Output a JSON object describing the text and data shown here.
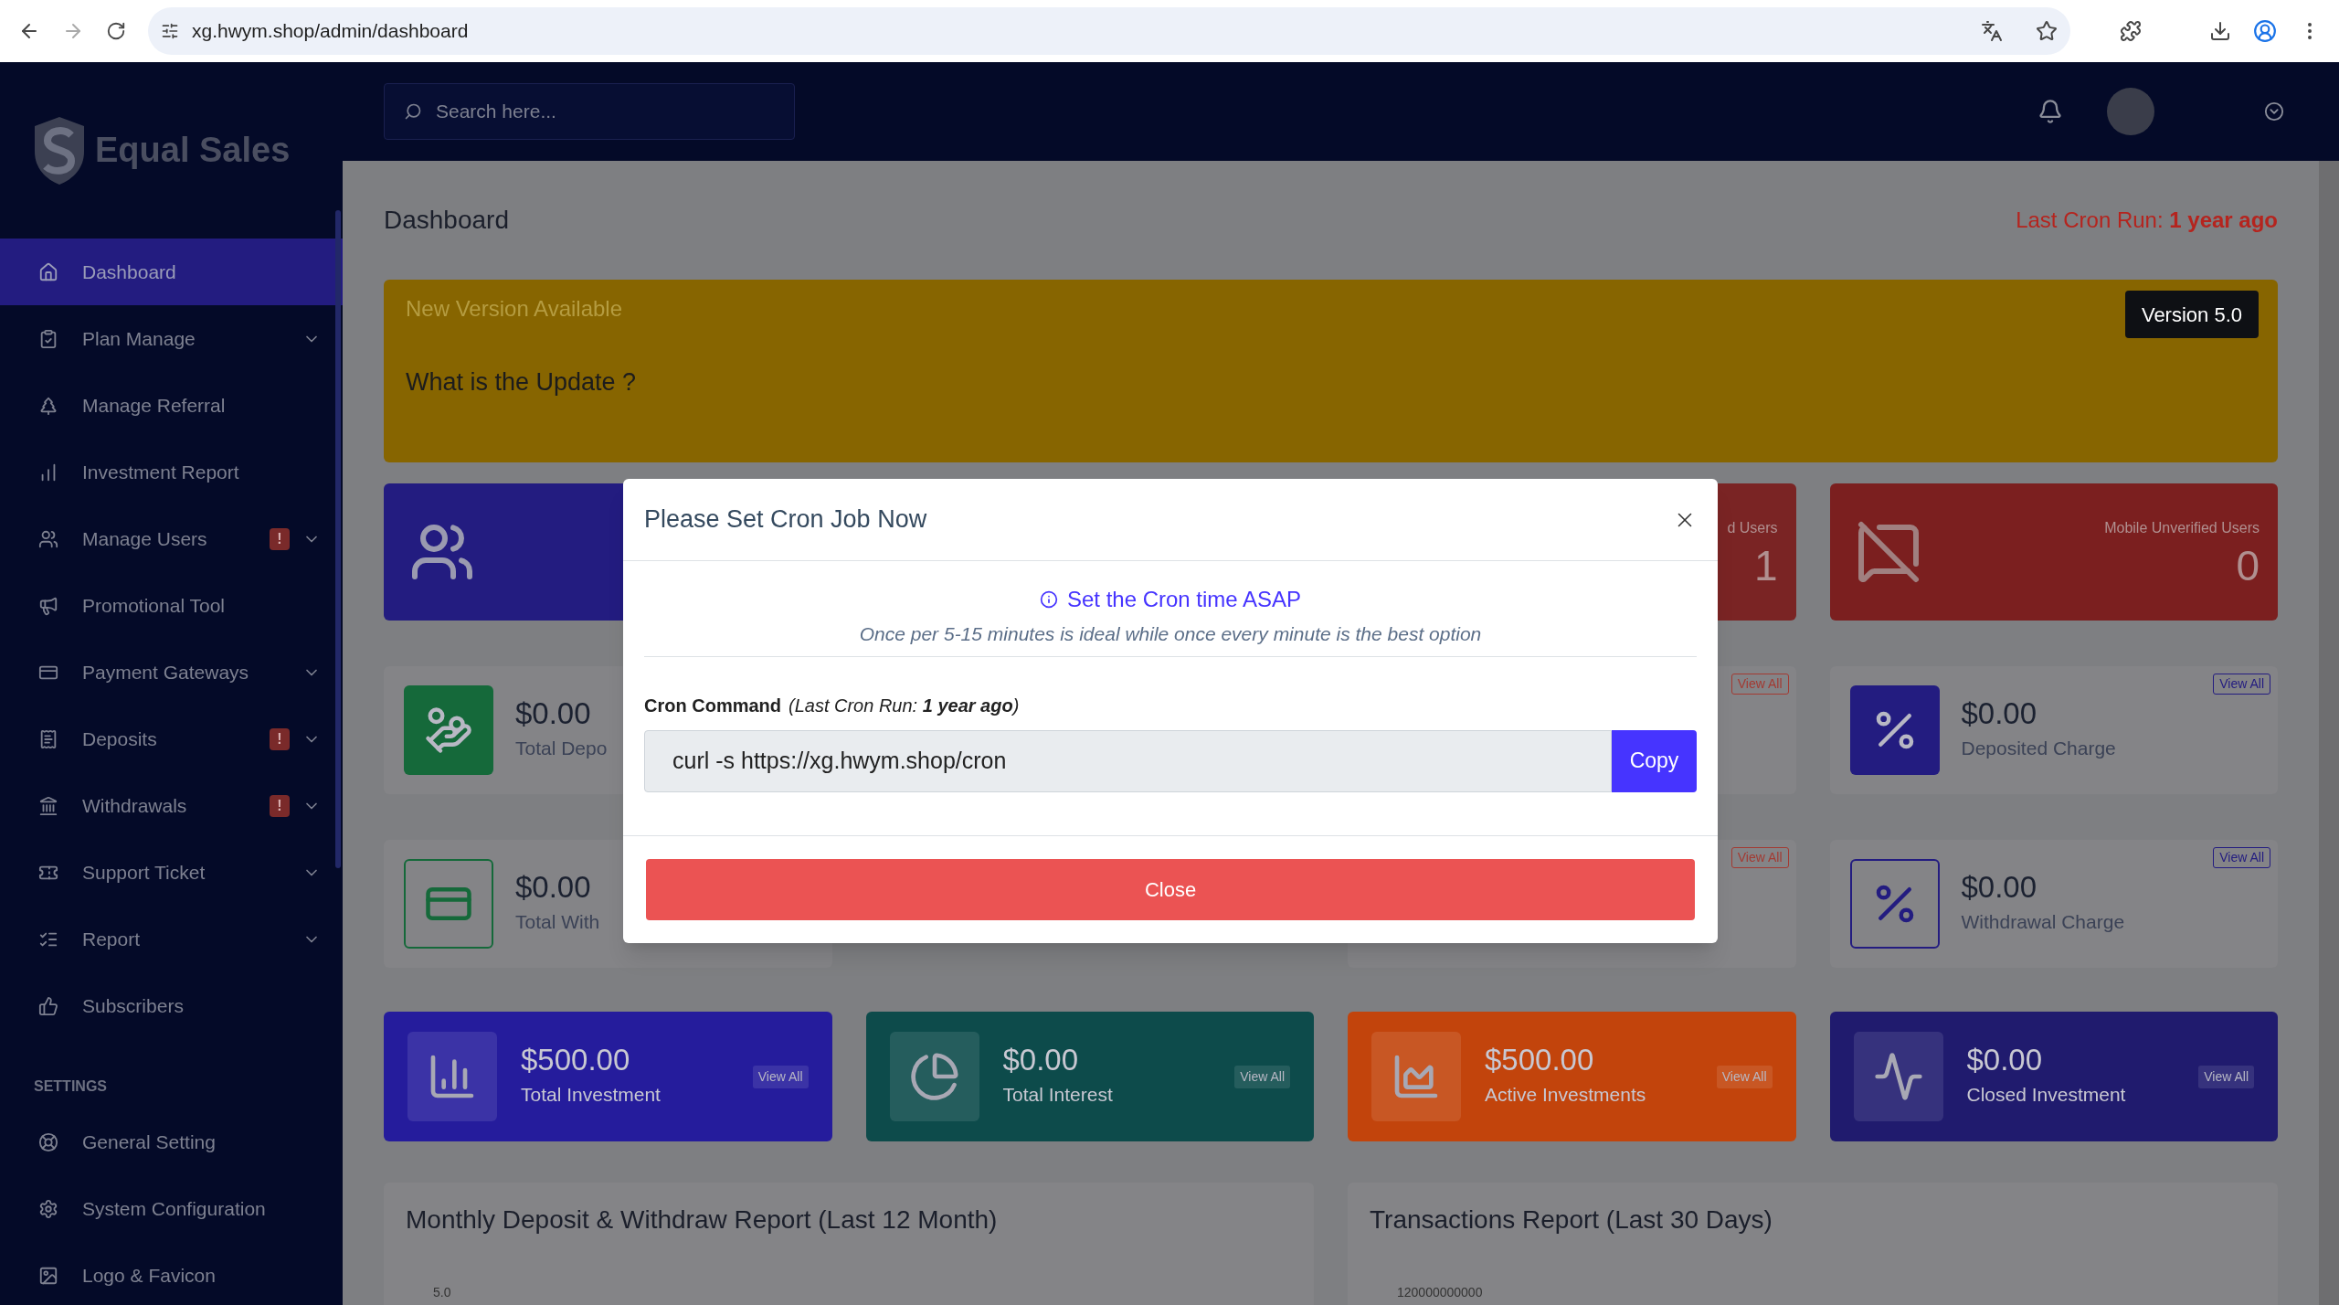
{
  "browser": {
    "url": "xg.hwym.shop/admin/dashboard"
  },
  "sidebar": {
    "brand": "Equal Sales",
    "items": [
      {
        "label": "Dashboard",
        "selected": true,
        "submenu": false
      },
      {
        "label": "Plan Manage",
        "selected": false,
        "submenu": true
      },
      {
        "label": "Manage Referral",
        "selected": false,
        "submenu": false
      },
      {
        "label": "Investment Report",
        "selected": false,
        "submenu": false
      },
      {
        "label": "Manage Users",
        "selected": false,
        "submenu": true,
        "badge": "!"
      },
      {
        "label": "Promotional Tool",
        "selected": false,
        "submenu": false
      },
      {
        "label": "Payment Gateways",
        "selected": false,
        "submenu": true
      },
      {
        "label": "Deposits",
        "selected": false,
        "submenu": true,
        "badge": "!"
      },
      {
        "label": "Withdrawals",
        "selected": false,
        "submenu": true,
        "badge": "!"
      },
      {
        "label": "Support Ticket",
        "selected": false,
        "submenu": true
      },
      {
        "label": "Report",
        "selected": false,
        "submenu": true
      },
      {
        "label": "Subscribers",
        "selected": false,
        "submenu": false
      }
    ],
    "settings_heading": "SETTINGS",
    "settings_items": [
      {
        "label": "General Setting",
        "selected": false,
        "submenu": false
      },
      {
        "label": "System Configuration",
        "selected": false,
        "submenu": false
      },
      {
        "label": "Logo & Favicon",
        "selected": false,
        "submenu": false
      }
    ]
  },
  "header": {
    "search": {
      "placeholder": "Search here..."
    }
  },
  "page": {
    "title": "Dashboard",
    "last_cron": "Last Cron Run: **1 year ago**"
  },
  "banner": {
    "heading": "New Version Available",
    "question": "What is the Update ?",
    "version_button": "Version 5.0"
  },
  "widget_rows": [
    [
      {
        "kind": "solid",
        "color": "#231c80"
      },
      {
        "kind": "covered"
      },
      {
        "kind": "solid",
        "color": "#7a2424",
        "label": "d Users",
        "value": "1"
      },
      {
        "kind": "solid",
        "color": "#7b1f1f",
        "label": "Mobile Unverified Users",
        "value": "0"
      }
    ],
    [
      {
        "kind": "light",
        "color": "#15693a",
        "value": "$0.00",
        "label": "Total Depo"
      },
      {
        "kind": "covered"
      },
      {
        "kind": "light",
        "color": "#a33a32",
        "view_all": "View All"
      },
      {
        "kind": "light",
        "color": "#231c80",
        "value": "$0.00",
        "label": "Deposited Charge",
        "view_all": "View All"
      }
    ],
    [
      {
        "kind": "outline",
        "color": "#15693a",
        "value": "$0.00",
        "label": "Total With"
      },
      {
        "kind": "covered"
      },
      {
        "kind": "outline",
        "color": "#a33a32",
        "view_all": "View All"
      },
      {
        "kind": "outline",
        "color": "#231c80",
        "value": "$0.00",
        "label": "Withdrawal Charge",
        "view_all": "View All"
      }
    ]
  ],
  "investment_cards": [
    {
      "color": "#251c9c",
      "value": "$500.00",
      "label": "Total Investment",
      "view_all": "View All"
    },
    {
      "color": "#0d4b4b",
      "value": "$0.00",
      "label": "Total Interest",
      "view_all": "View All"
    },
    {
      "color": "#c2440c",
      "value": "$500.00",
      "label": "Active Investments",
      "view_all": "View All"
    },
    {
      "color": "#201b6e",
      "value": "$0.00",
      "label": "Closed Investment",
      "view_all": "View All"
    }
  ],
  "reports": [
    {
      "title": "Monthly Deposit & Withdraw Report (Last 12 Month)",
      "axis_tick": "5.0"
    },
    {
      "title": "Transactions Report (Last 30 Days)",
      "axis_tick": "120000000000"
    }
  ],
  "modal": {
    "title": "Please Set Cron Job Now",
    "info": "Set the Cron time ASAP",
    "note": "Once per 5-15 minutes is ideal while once every minute is the best option",
    "command_label": "Cron Command",
    "command_note": "(Last Cron Run: **1 year ago**)",
    "command": "curl -s https://xg.hwym.shop/cron",
    "copy_button": "Copy",
    "close_button": "Close"
  }
}
